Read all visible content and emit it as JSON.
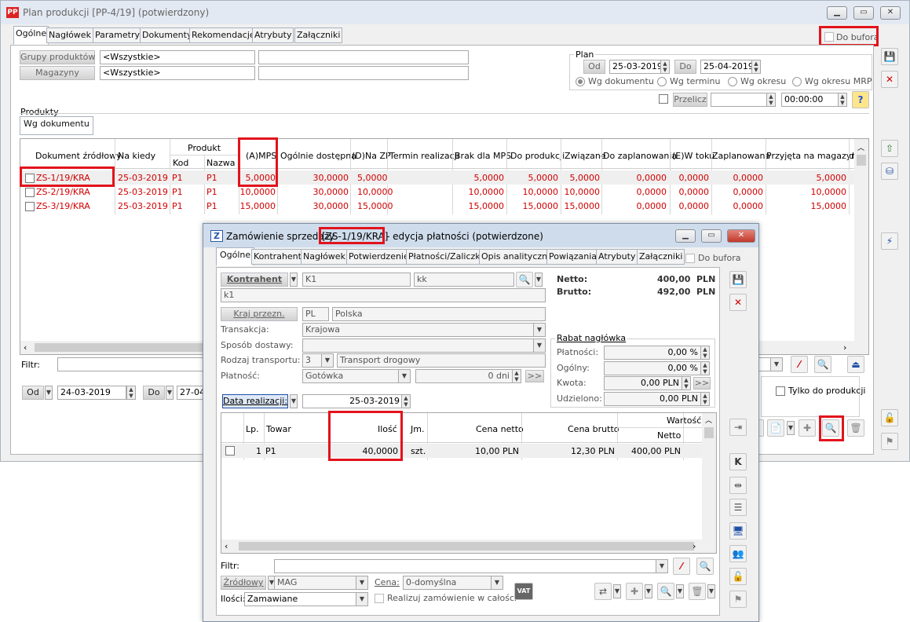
{
  "main": {
    "title": "Plan produkcji [PP-4/19]  (potwierdzony)",
    "tabs": [
      "Ogólne",
      "Nagłówek",
      "Parametry",
      "Dokumenty",
      "Rekomendacje",
      "Atrybuty",
      "Załączniki"
    ],
    "do_bufora": "Do bufora",
    "grupy_produktow_label": "Grupy produktów",
    "grupy_produktow_value": "<Wszystkie>",
    "magazyny_label": "Magazyny",
    "magazyny_value": "<Wszystkie>",
    "plan": {
      "label": "Plan",
      "od_label": "Od",
      "od_value": "25-03-2019",
      "do_label": "Do",
      "do_value": "25-04-2019",
      "radios": [
        "Wg dokumentu",
        "Wg terminu",
        "Wg okresu",
        "Wg okresu MRP"
      ],
      "przelicz_label": "Przelicz",
      "time_value": "00:00:00"
    },
    "produkty_label": "Produkty",
    "wg_dokumentu_tab": "Wg dokumentu",
    "table": {
      "headers": {
        "dokument": "Dokument źródłowy",
        "na_kiedy": "Na kiedy",
        "produkt": "Produkt",
        "kod": "Kod",
        "nazwa": "Nazwa",
        "mps": "(A)MPS",
        "ogolnie": "Ogólnie dostępna",
        "nazp": "(D)Na ZP",
        "termin": "Termin realizacji",
        "brak": "Brak dla MPS",
        "doprod": "Do produkcji",
        "zwiazane": "Związane",
        "dozapl": "Do zaplanowania",
        "wtoku": "(E)W toku",
        "zaplanowana": "Zaplanowana",
        "przyjeta": "Przyjęta na magazyn",
        "extra": "d"
      },
      "rows": [
        {
          "dok": "ZS-1/19/KRA",
          "data": "25-03-2019",
          "kod": "P1",
          "nazwa": "P1",
          "mps": "5,0000",
          "ogolnie": "30,0000",
          "nazp": "5,0000",
          "brak": "5,0000",
          "doprod": "5,0000",
          "zwiazane": "5,0000",
          "dozapl": "0,0000",
          "wtoku": "0,0000",
          "zapl": "0,0000",
          "przyjeta": "5,0000"
        },
        {
          "dok": "ZS-2/19/KRA",
          "data": "25-03-2019",
          "kod": "P1",
          "nazwa": "P1",
          "mps": "10,0000",
          "ogolnie": "30,0000",
          "nazp": "10,0000",
          "brak": "10,0000",
          "doprod": "10,0000",
          "zwiazane": "10,0000",
          "dozapl": "0,0000",
          "wtoku": "0,0000",
          "zapl": "0,0000",
          "przyjeta": "10,0000"
        },
        {
          "dok": "ZS-3/19/KRA",
          "data": "25-03-2019",
          "kod": "P1",
          "nazwa": "P1",
          "mps": "15,0000",
          "ogolnie": "30,0000",
          "nazp": "15,0000",
          "brak": "15,0000",
          "doprod": "15,0000",
          "zwiazane": "15,0000",
          "dozapl": "0,0000",
          "wtoku": "0,0000",
          "zapl": "0,0000",
          "przyjeta": "15,0000"
        }
      ]
    },
    "filtr_label": "Filtr:",
    "bottom": {
      "od_label": "Od",
      "od_value": "24-03-2019",
      "do_label": "Do",
      "do_value": "27-04",
      "tylko_do_produkcji": "Tylko do produkcji"
    }
  },
  "dialog": {
    "title_prefix": "Zamówienie sprzedaży",
    "title_doc": "[ZS-1/19/KRA]",
    "title_suffix": "- edycja płatności  (potwierdzone)",
    "tabs": [
      "Ogólne",
      "Kontrahent",
      "Nagłówek",
      "Potwierdzenie",
      "Płatności/Zaliczki",
      "Opis analityczny",
      "Powiązania",
      "Atrybuty",
      "Załączniki"
    ],
    "do_bufora": "Do bufora",
    "kontrahent_label": "Kontrahent",
    "kontrahent_code": "K1",
    "kontrahent_name": "kk",
    "kontrahent_line2": "k1",
    "netto_label": "Netto:",
    "netto_value": "400,00",
    "netto_cur": "PLN",
    "brutto_label": "Brutto:",
    "brutto_value": "492,00",
    "brutto_cur": "PLN",
    "kraj_label": "Kraj przezn.",
    "kraj_code": "PL",
    "kraj_name": "Polska",
    "transakcja_label": "Transakcja:",
    "transakcja_value": "Krajowa",
    "sposob_label": "Sposób dostawy:",
    "sposob_value": "",
    "rodzaj_label": "Rodzaj transportu:",
    "rodzaj_code": "3",
    "rodzaj_value": "Transport drogowy",
    "platnosc_label": "Płatność:",
    "platnosc_value": "Gotówka",
    "platnosc_dni": "0 dni",
    "rabat": {
      "title": "Rabat nagłówka",
      "platnosci_label": "Płatności:",
      "platnosci_value": "0,00 %",
      "ogolny_label": "Ogólny:",
      "ogolny_value": "0,00 %",
      "kwota_label": "Kwota:",
      "kwota_value": "0,00 PLN",
      "udzielono_label": "Udzielono:",
      "udzielono_value": "0,00 PLN"
    },
    "data_realizacji_label": "Data realizacji:",
    "data_realizacji_value": "25-03-2019",
    "table": {
      "headers": {
        "lp": "Lp.",
        "towar": "Towar",
        "ilosc": "Ilość",
        "jm": "Jm.",
        "cena_netto": "Cena netto",
        "cena_brutto": "Cena brutto",
        "wartosc": "Wartość",
        "netto": "Netto"
      },
      "rows": [
        {
          "lp": "1",
          "towar": "P1",
          "ilosc": "40,0000",
          "jm": "szt.",
          "cena_netto": "10,00 PLN",
          "cena_brutto": "12,30 PLN",
          "netto": "400,00 PLN"
        }
      ]
    },
    "filtr_label": "Filtr:",
    "zrodlowy_label": "Źródłowy",
    "zrodlowy_value": "MAG",
    "cena_label": "Cena:",
    "cena_value": "0-domyślna",
    "ilosci_label": "Ilości:",
    "ilosci_value": "Zamawiane",
    "realizuj_label": "Realizuj zamówienie w całości",
    "vat_label": "VAT"
  }
}
